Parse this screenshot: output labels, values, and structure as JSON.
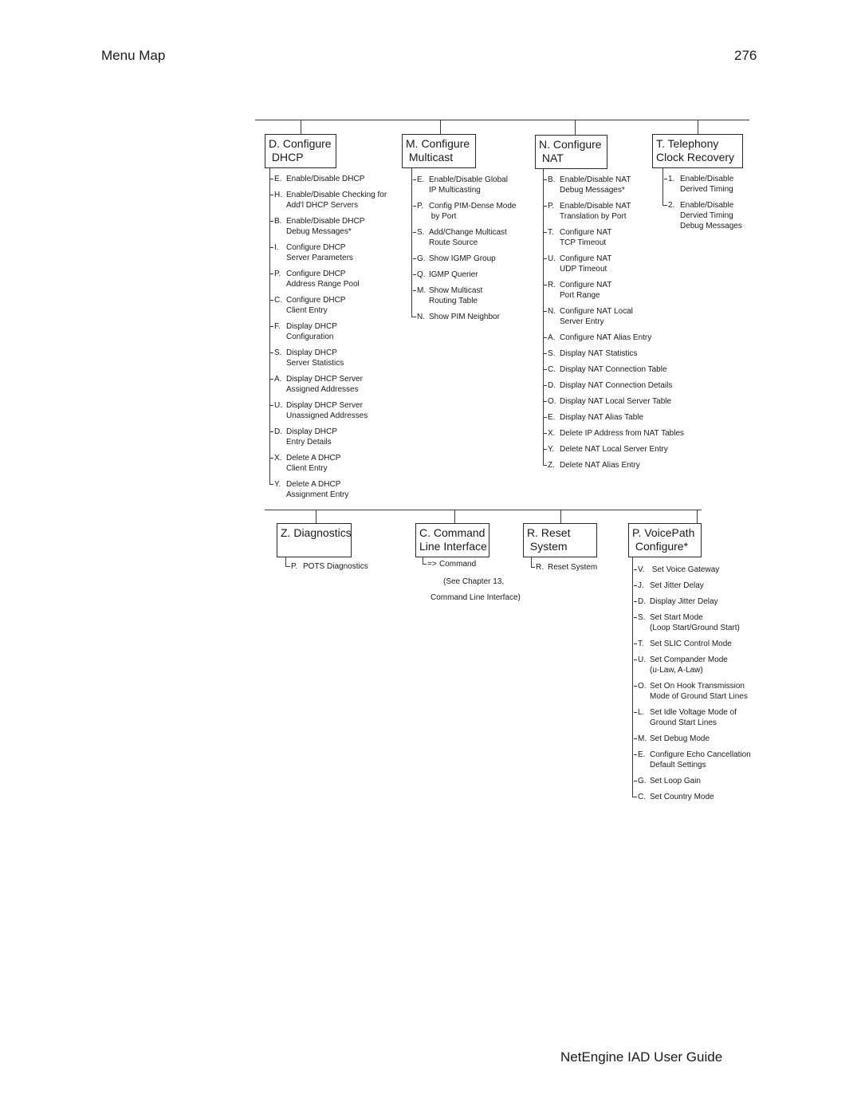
{
  "header": {
    "section": "Menu Map",
    "page_number": "276"
  },
  "footer": {
    "title": "NetEngine IAD User Guide"
  },
  "top_row": [
    {
      "key": "D.",
      "title": "Configure\n DHCP",
      "items": [
        {
          "key": "E.",
          "text": "Enable/Disable DHCP"
        },
        {
          "key": "H.",
          "text": "Enable/Disable Checking for\nAdd'l DHCP Servers"
        },
        {
          "key": "B.",
          "text": "Enable/Disable DHCP\nDebug Messages*"
        },
        {
          "key": "I.",
          "text": "Configure DHCP\nServer Parameters"
        },
        {
          "key": "P.",
          "text": "Configure DHCP\nAddress Range Pool"
        },
        {
          "key": "C.",
          "text": "Configure DHCP\nClient Entry"
        },
        {
          "key": "F.",
          "text": "Display DHCP\nConfiguration"
        },
        {
          "key": "S.",
          "text": "Display DHCP\nServer Statistics"
        },
        {
          "key": "A.",
          "text": "Display DHCP Server\nAssigned Addresses"
        },
        {
          "key": "U.",
          "text": "Display DHCP Server\nUnassigned Addresses"
        },
        {
          "key": "D.",
          "text": "Display DHCP\nEntry Details"
        },
        {
          "key": "X.",
          "text": "Delete A DHCP\nClient Entry"
        },
        {
          "key": "Y.",
          "text": "Delete A DHCP\nAssignment Entry"
        }
      ]
    },
    {
      "key": "M.",
      "title": "Configure\n Multicast",
      "items": [
        {
          "key": "E.",
          "text": "Enable/Disable Global\nIP Multicasting"
        },
        {
          "key": "P.",
          "text": "Config PIM-Dense Mode\n by Port"
        },
        {
          "key": "S.",
          "text": "Add/Change Multicast\nRoute Source"
        },
        {
          "key": "G.",
          "text": "Show IGMP Group"
        },
        {
          "key": "Q.",
          "text": "IGMP Querier"
        },
        {
          "key": "M.",
          "text": "Show Multicast\nRouting Table"
        },
        {
          "key": "N.",
          "text": "Show PIM Neighbor"
        }
      ]
    },
    {
      "key": "N.",
      "title": "Configure\n NAT",
      "items": [
        {
          "key": "B.",
          "text": "Enable/Disable NAT\nDebug Messages*"
        },
        {
          "key": "P.",
          "text": "Enable/Disable NAT\nTranslation by Port"
        },
        {
          "key": "T.",
          "text": "Configure NAT\nTCP Timeout"
        },
        {
          "key": "U.",
          "text": "Configure NAT\nUDP Timeout"
        },
        {
          "key": "R.",
          "text": "Configure NAT\nPort Range"
        },
        {
          "key": "N.",
          "text": "Configure NAT Local\nServer Entry"
        },
        {
          "key": "A.",
          "text": "Configure NAT Alias Entry"
        },
        {
          "key": "S.",
          "text": "Display NAT Statistics"
        },
        {
          "key": "C.",
          "text": "Display NAT Connection Table"
        },
        {
          "key": "D.",
          "text": "Display NAT Connection Details"
        },
        {
          "key": "O.",
          "text": "Display NAT Local Server Table"
        },
        {
          "key": "E.",
          "text": "Display NAT Alias Table"
        },
        {
          "key": "X.",
          "text": "Delete IP Address from NAT Tables"
        },
        {
          "key": "Y.",
          "text": "Delete NAT Local Server Entry"
        },
        {
          "key": "Z.",
          "text": "Delete NAT Alias Entry"
        }
      ]
    },
    {
      "key": "T.",
      "title": "Telephony\nClock Recovery",
      "items": [
        {
          "key": "1.",
          "text": "Enable/Disable\nDerived Timing"
        },
        {
          "key": "2.",
          "text": "Enable/Disable\nDervied Timing\nDebug Messages"
        }
      ]
    }
  ],
  "bottom_row": [
    {
      "key": "Z.",
      "title": "Diagnostics",
      "items": [
        {
          "key": "P.",
          "text": "POTS Diagnostics"
        }
      ]
    },
    {
      "key": "C.",
      "title": "Command\nLine Interface",
      "items": [
        {
          "key": "=>",
          "text": "Command"
        }
      ],
      "note": [
        "(See Chapter 13,",
        "Command Line Interface)"
      ]
    },
    {
      "key": "R.",
      "title": "Reset\n System",
      "items": [
        {
          "key": "R.",
          "text": "Reset System"
        }
      ]
    },
    {
      "key": "P.",
      "title": "VoicePath\n Configure*",
      "items": [
        {
          "key": "V.",
          "text": " Set Voice Gateway"
        },
        {
          "key": "J.",
          "text": "Set Jitter Delay"
        },
        {
          "key": "D.",
          "text": "Display Jitter Delay"
        },
        {
          "key": "S.",
          "text": "Set Start Mode\n(Loop Start/Ground Start)"
        },
        {
          "key": "T.",
          "text": "Set SLIC Control Mode"
        },
        {
          "key": "U.",
          "text": "Set Compander Mode\n(u-Law, A-Law)"
        },
        {
          "key": "O.",
          "text": "Set On Hook Transmission\nMode of Ground Start Lines"
        },
        {
          "key": "L.",
          "text": "Set Idle Voltage Mode of\nGround Start Lines"
        },
        {
          "key": "M.",
          "text": "Set Debug Mode"
        },
        {
          "key": "E.",
          "text": "Configure Echo Cancellation\nDefault Settings"
        },
        {
          "key": "G.",
          "text": "Set Loop Gain"
        },
        {
          "key": "C.",
          "text": "Set Country Mode"
        }
      ]
    }
  ]
}
